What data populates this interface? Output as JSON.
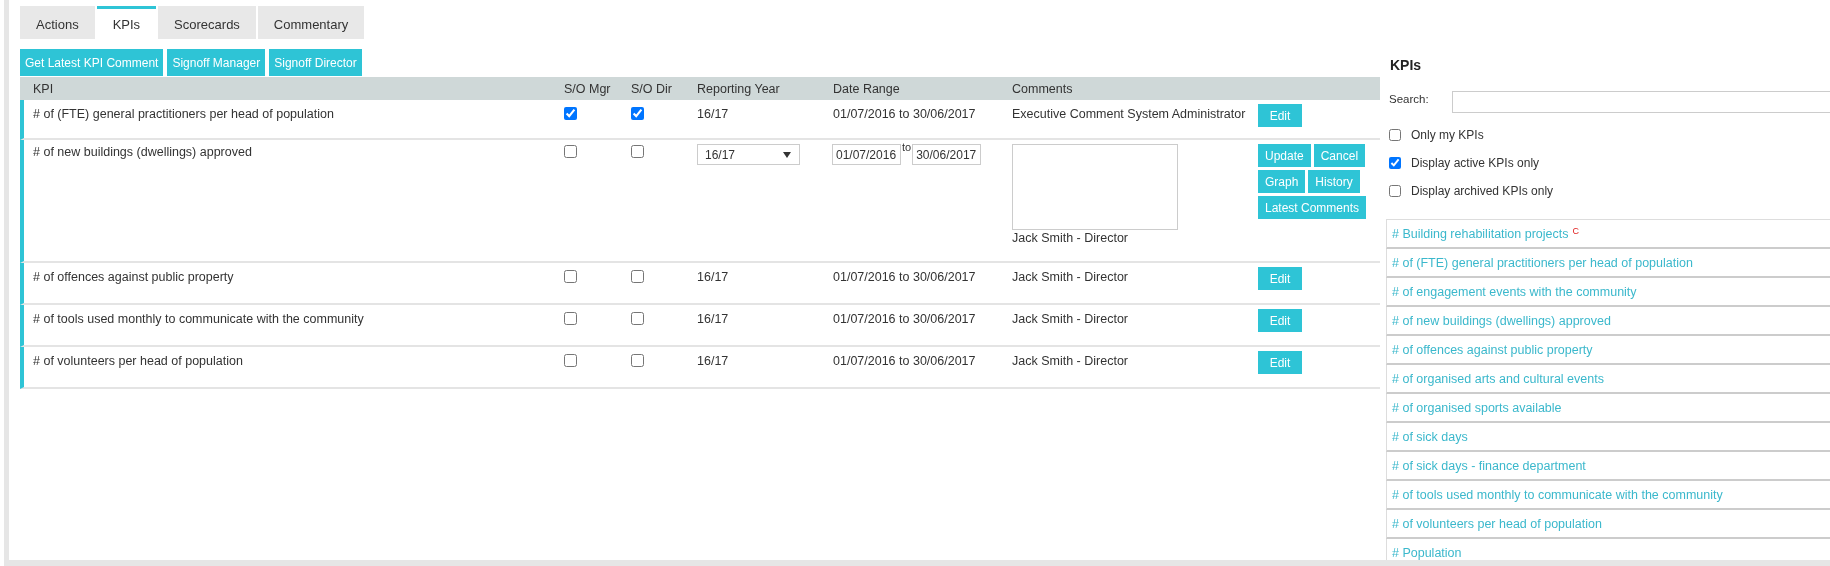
{
  "tabs": [
    {
      "label": "Actions",
      "selected": false
    },
    {
      "label": "KPIs",
      "selected": true
    },
    {
      "label": "Scorecards",
      "selected": false
    },
    {
      "label": "Commentary",
      "selected": false
    }
  ],
  "toolbar": [
    "Get Latest KPI Comment",
    "Signoff Manager",
    "Signoff Director"
  ],
  "table": {
    "columns": [
      "KPI",
      "S/O Mgr",
      "S/O Dir",
      "Reporting Year",
      "Date Range",
      "Comments"
    ],
    "rows": [
      {
        "kind": "view",
        "kpi": "# of (FTE) general practitioners per head of population",
        "mgr_checked": true,
        "dir_checked": true,
        "year": "16/17",
        "date_range": "01/07/2016 to 30/06/2017",
        "comment": "Executive Comment System Administrator",
        "actions": [
          "Edit"
        ]
      },
      {
        "kind": "edit",
        "kpi": "# of new buildings (dwellings) approved",
        "mgr_checked": false,
        "dir_checked": false,
        "year": "16/17",
        "date_from": "01/07/2016",
        "date_sep": "to",
        "date_to": "30/06/2017",
        "comment": "Jack Smith - Director",
        "actions": [
          "Update",
          "Cancel",
          "Graph",
          "History",
          "Latest Comments"
        ]
      },
      {
        "kind": "view",
        "kpi": "# of offences against public property",
        "mgr_checked": false,
        "dir_checked": false,
        "year": "16/17",
        "date_range": "01/07/2016 to 30/06/2017",
        "comment": "Jack Smith - Director",
        "actions": [
          "Edit"
        ]
      },
      {
        "kind": "view",
        "kpi": "# of tools used monthly to communicate with the community",
        "mgr_checked": false,
        "dir_checked": false,
        "year": "16/17",
        "date_range": "01/07/2016 to 30/06/2017",
        "comment": "Jack Smith - Director",
        "actions": [
          "Edit"
        ]
      },
      {
        "kind": "view",
        "kpi": "# of volunteers per head of population",
        "mgr_checked": false,
        "dir_checked": false,
        "year": "16/17",
        "date_range": "01/07/2016 to 30/06/2017",
        "comment": "Jack Smith - Director",
        "actions": [
          "Edit"
        ]
      }
    ]
  },
  "sidebar": {
    "title": "KPIs",
    "search_label": "Search:",
    "filters": [
      {
        "label": "Only my KPIs",
        "checked": false
      },
      {
        "label": "Display active KPIs only",
        "checked": true
      },
      {
        "label": "Display archived KPIs only",
        "checked": false
      }
    ],
    "items": [
      {
        "label": "# Building rehabilitation projects",
        "badge": "C"
      },
      {
        "label": "# of (FTE) general practitioners per head of population"
      },
      {
        "label": "# of engagement events with the community"
      },
      {
        "label": "# of new buildings (dwellings) approved"
      },
      {
        "label": "# of offences against public property"
      },
      {
        "label": "# of organised arts and cultural events"
      },
      {
        "label": "# of organised sports available"
      },
      {
        "label": "# of sick days"
      },
      {
        "label": "# of sick days - finance department"
      },
      {
        "label": "# of tools used monthly to communicate with the community"
      },
      {
        "label": "# of volunteers per head of population"
      },
      {
        "label": "# Population"
      }
    ]
  }
}
